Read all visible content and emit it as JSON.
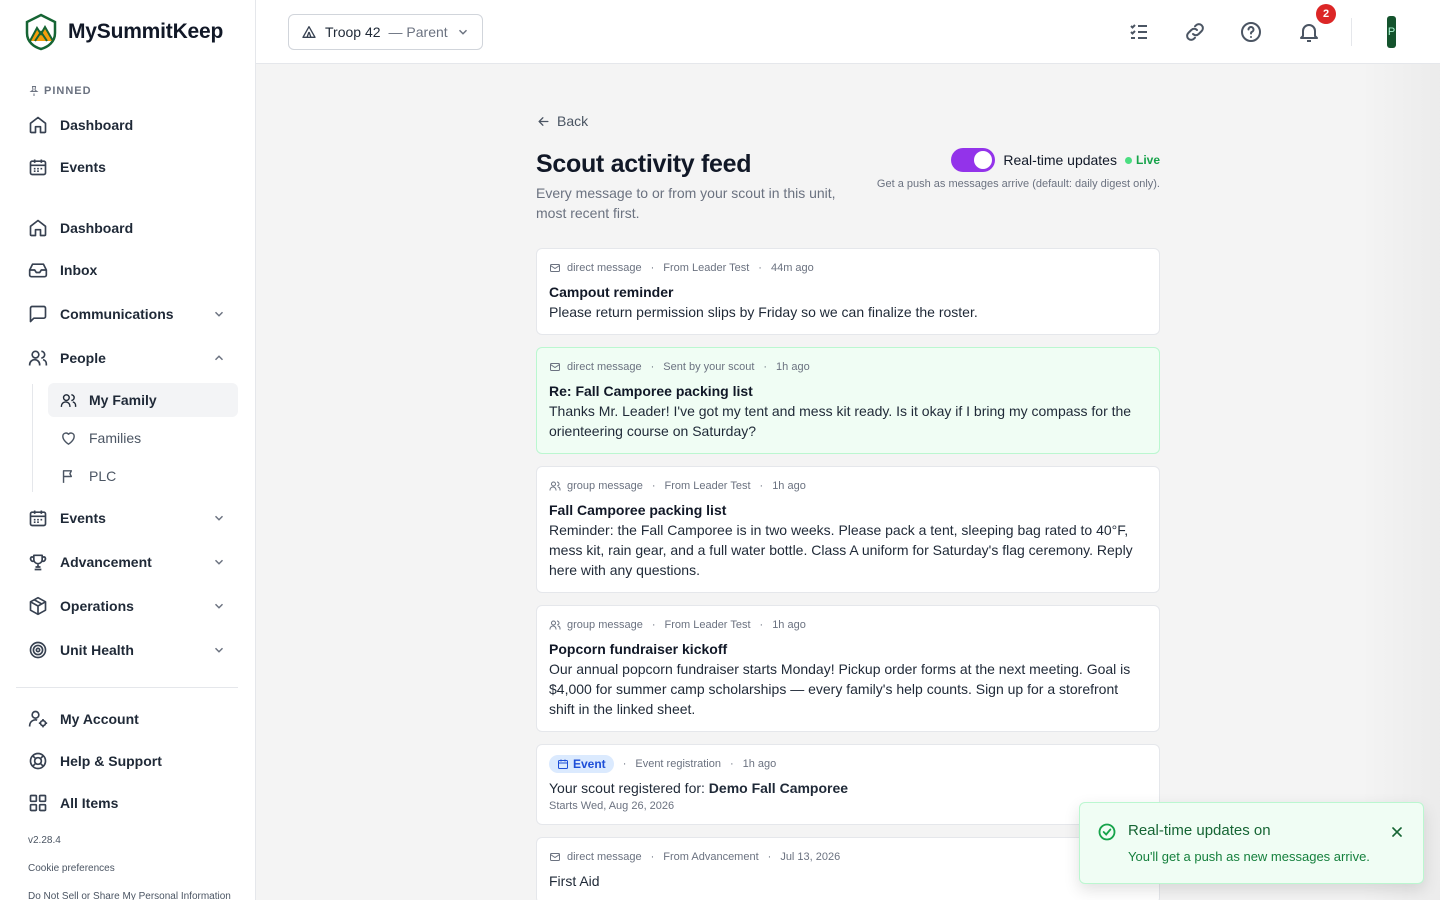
{
  "app": {
    "name": "MySummitKeep"
  },
  "sidebar": {
    "pinned_label": "PINNED",
    "pinned": [
      {
        "label": "Dashboard",
        "icon": "home-icon"
      },
      {
        "label": "Events",
        "icon": "calendar-icon"
      }
    ],
    "items": [
      {
        "label": "Dashboard",
        "icon": "home-icon"
      },
      {
        "label": "Inbox",
        "icon": "inbox-icon"
      },
      {
        "label": "Communications",
        "icon": "message-square-icon",
        "expanded": false
      },
      {
        "label": "People",
        "icon": "users-icon",
        "expanded": true
      },
      {
        "label": "Events",
        "icon": "calendar-icon",
        "expanded": false
      },
      {
        "label": "Advancement",
        "icon": "trophy-icon",
        "expanded": false
      },
      {
        "label": "Operations",
        "icon": "box-icon",
        "expanded": false
      },
      {
        "label": "Unit Health",
        "icon": "target-icon",
        "expanded": false
      }
    ],
    "people_sub": [
      {
        "label": "My Family",
        "icon": "users-icon",
        "active": true
      },
      {
        "label": "Families",
        "icon": "heart-icon"
      },
      {
        "label": "PLC",
        "icon": "flag-icon"
      }
    ],
    "bottom": [
      {
        "label": "My Account",
        "icon": "user-cog-icon"
      },
      {
        "label": "Help & Support",
        "icon": "life-buoy-icon"
      },
      {
        "label": "All Items",
        "icon": "grid-icon"
      }
    ],
    "version": "v2.28.4",
    "cookie": "Cookie preferences",
    "privacy": "Do Not Sell or Share My Personal Information"
  },
  "topbar": {
    "troop": "Troop 42",
    "role": "— Parent",
    "notifications": "2",
    "avatar": "P"
  },
  "page": {
    "back": "Back",
    "title": "Scout activity feed",
    "subtitle": "Every message to or from your scout in this unit, most recent first.",
    "realtime": {
      "label": "Real-time updates",
      "enabled": true,
      "status": "Live",
      "description": "Get a push as messages arrive (default: daily digest only).",
      "accent": "#9333ea"
    }
  },
  "feed": [
    {
      "type": "direct message",
      "from": "From Leader Test",
      "time": "44m ago",
      "title": "Campout reminder",
      "body": "Please return permission slips by Friday so we can finalize the roster."
    },
    {
      "type": "direct message",
      "from": "Sent by your scout",
      "time": "1h ago",
      "title": "Re: Fall Camporee packing list",
      "body": "Thanks Mr. Leader! I've got my tent and mess kit ready. Is it okay if I bring my compass for the orienteering course on Saturday?"
    },
    {
      "type": "group message",
      "from": "From Leader Test",
      "time": "1h ago",
      "title": "Fall Camporee packing list",
      "body": "Reminder: the Fall Camporee is in two weeks. Please pack a tent, sleeping bag rated to 40°F, mess kit, rain gear, and a full water bottle. Class A uniform for Saturday's flag ceremony. Reply here with any questions."
    },
    {
      "type": "group message",
      "from": "From Leader Test",
      "time": "1h ago",
      "title": "Popcorn fundraiser kickoff",
      "body": "Our annual popcorn fundraiser starts Monday! Pickup order forms at the next meeting. Goal is $4,000 for summer camp scholarships — every family's help counts. Sign up for a storefront shift in the linked sheet."
    },
    {
      "chip": "Event",
      "from": "Event registration",
      "time": "1h ago",
      "text": "Your scout registered for: ",
      "event_name": "Demo Fall Camporee",
      "starts": "Starts Wed, Aug 26, 2026"
    },
    {
      "type": "direct message",
      "from": "From Advancement",
      "time": "Jul 13, 2026",
      "text": "First Aid"
    }
  ],
  "toast": {
    "title": "Real-time updates on",
    "message": "You'll get a push as new messages arrive."
  }
}
